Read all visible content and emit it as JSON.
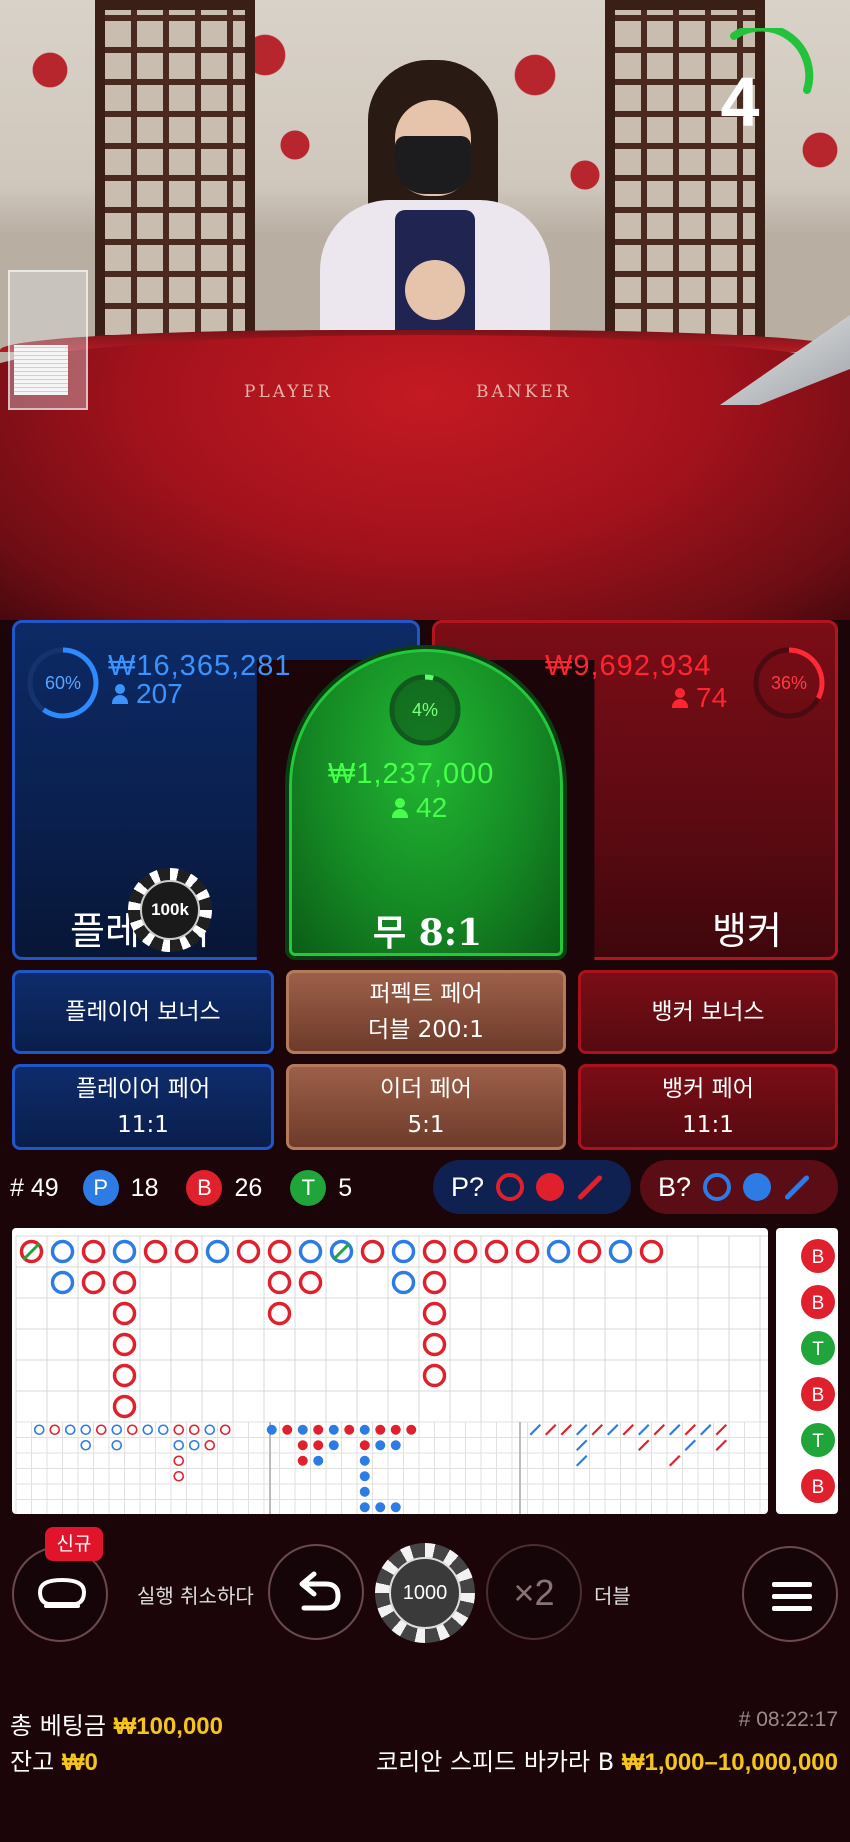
{
  "countdown": "4",
  "table_labels": {
    "player": "PLAYER",
    "banker": "BANKER"
  },
  "player": {
    "percent": "60%",
    "percent_value": 0.6,
    "amount": "₩16,365,281",
    "bettors": "207",
    "name": "플레이어"
  },
  "tie": {
    "percent": "4%",
    "percent_value": 0.04,
    "amount": "₩1,237,000",
    "bettors": "42",
    "name": "무 8:1"
  },
  "banker": {
    "percent": "36%",
    "percent_value": 0.36,
    "amount": "₩9,692,934",
    "bettors": "74",
    "name": "뱅커"
  },
  "placed_chip": "100k",
  "side_bets": {
    "player_bonus": "플레이어 보너스",
    "perfect_pair": {
      "label": "퍼펙트 페어",
      "odds": "더블 200:1"
    },
    "banker_bonus": "뱅커 보너스",
    "player_pair": {
      "label": "플레이어 페어",
      "odds": "11:1"
    },
    "either_pair": {
      "label": "이더 페어",
      "odds": "5:1"
    },
    "banker_pair": {
      "label": "뱅커 페어",
      "odds": "11:1"
    }
  },
  "stats": {
    "round": "# 49",
    "player_letter": "P",
    "player_count": "18",
    "banker_letter": "B",
    "banker_count": "26",
    "tie_letter": "T",
    "tie_count": "5"
  },
  "predict": {
    "player": "P?",
    "banker": "B?"
  },
  "colors": {
    "player": "#2d7be4",
    "banker": "#e0202c",
    "tie": "#1fa53a",
    "gold": "#f4c51d"
  },
  "bead_road": [
    "B",
    "B",
    "T",
    "B",
    "T",
    "B"
  ],
  "controls": {
    "new_badge": "신규",
    "undo_label": "실행 취소하다",
    "chip_value": "1000",
    "double_symbol": "×2",
    "double_label": "더블"
  },
  "footer": {
    "total_bet_label": "총 베팅금",
    "total_bet": "₩100,000",
    "balance_label": "잔고",
    "balance": "₩0",
    "round_id": "# 08:22:17",
    "table_name": "코리안 스피드 바카라 B",
    "limits": "₩1,000–10,000,000"
  }
}
